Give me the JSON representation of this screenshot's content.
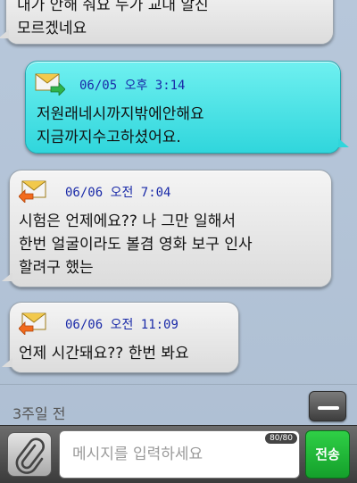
{
  "messages": [
    {
      "direction": "in",
      "time": "",
      "lines": [
        "내가 안해 줘요 누가 교대 알진",
        "모르겠네요"
      ]
    },
    {
      "direction": "out",
      "time": "06/05 오후 3:14",
      "lines": [
        "저원래네시까지밖에안해요",
        "지금까지수고하셨어요."
      ]
    },
    {
      "direction": "in",
      "time": "06/06 오전 7:04",
      "lines": [
        "시험은 언제에요?? 나 그만 일해서",
        "한번 얼굴이라도 볼겸 영화 보구 인사",
        "할려구 했는"
      ]
    },
    {
      "direction": "in",
      "time": "06/06 오전 11:09",
      "lines": [
        "언제 시간돼요?? 한번 봐요"
      ]
    }
  ],
  "divider_label": "3주일 전",
  "composer": {
    "placeholder": "메시지를 입력하세요",
    "char_count": "80/80",
    "send_label": "전송"
  },
  "icons": {
    "attach": "paperclip-icon",
    "collapse": "minus-icon",
    "incoming": "mail-received-icon",
    "outgoing": "mail-sent-icon"
  },
  "colors": {
    "outgoing_bubble": "#30d6dc",
    "incoming_bubble": "#dcdcdc",
    "send_button": "#14a02b",
    "timestamp": "#1a2aa8"
  }
}
